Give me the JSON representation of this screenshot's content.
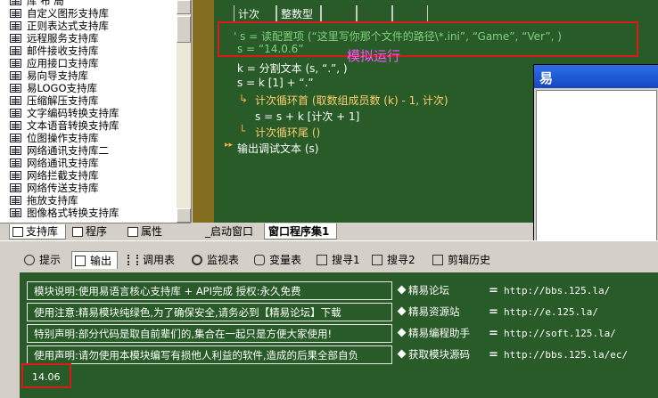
{
  "library_list": [
    "自定义图形支持库",
    "正则表达式支持库",
    "远程服务支持库",
    "邮件接收支持库",
    "应用接口支持库",
    "易向导支持库",
    "易LOGO支持库",
    "压缩解压支持库",
    "文字编码转换支持库",
    "文本语音转换支持库",
    "位图操作支持库",
    "网络通讯支持库二",
    "网络通讯支持库",
    "网络拦截支持库",
    "网络传送支持库",
    "拖放支持库",
    "图像格式转换支持库"
  ],
  "left_tabs": [
    "支持库",
    "程序",
    "属性"
  ],
  "code": {
    "table_headers": [
      "计次",
      "整数型"
    ],
    "line1": "' s = 读配置项 (“这里写你那个文件的路径\\*.ini”, “Game”, “Ver”, )",
    "line2": "s = “14.0.6”",
    "line3": "k = 分割文本 (s, “.”, )",
    "line4": "s = k [1] + “.”",
    "line5": "计次循环首 (取数组成员数 (k) - 1, 计次)",
    "line6": "s = s + k [计次 + 1]",
    "line7": "计次循环尾 ()",
    "line8": "输出调试文本 (s)",
    "annotation": "模拟运行"
  },
  "float_window": {
    "logo": "易"
  },
  "window_tabs": [
    "_启动窗口",
    "窗口程序集1"
  ],
  "output_tabs": [
    "提示",
    "输出",
    "调用表",
    "监视表",
    "变量表",
    "搜寻1",
    "搜寻2",
    "剪辑历史"
  ],
  "output": {
    "info": [
      "模块说明:使用易语言核心支持库 + API完成        授权:永久免费",
      "使用注意:精易模块纯绿色,为了确保安全,请务必到【精易论坛】下载",
      "特别声明:部分代码是取自前辈们的,集合在一起只是方便大家使用!",
      "使用声明:请勿使用本模块编写有损他人利益的软件,造成的后果全部自负"
    ],
    "links": [
      {
        "name": "精易论坛",
        "url": "http://bbs.125.la/"
      },
      {
        "name": "精易资源站",
        "url": "http://e.125.la/"
      },
      {
        "name": "精易编程助手",
        "url": "http://soft.125.la/"
      },
      {
        "name": "获取模块源码",
        "url": "http://bbs.125.la/ec/"
      }
    ],
    "result": "14.06"
  },
  "colors": {
    "editor_bg": "#285b28",
    "gutter": "#826e1e",
    "highlight": "#e01818",
    "annotation": "#ff55ff"
  }
}
